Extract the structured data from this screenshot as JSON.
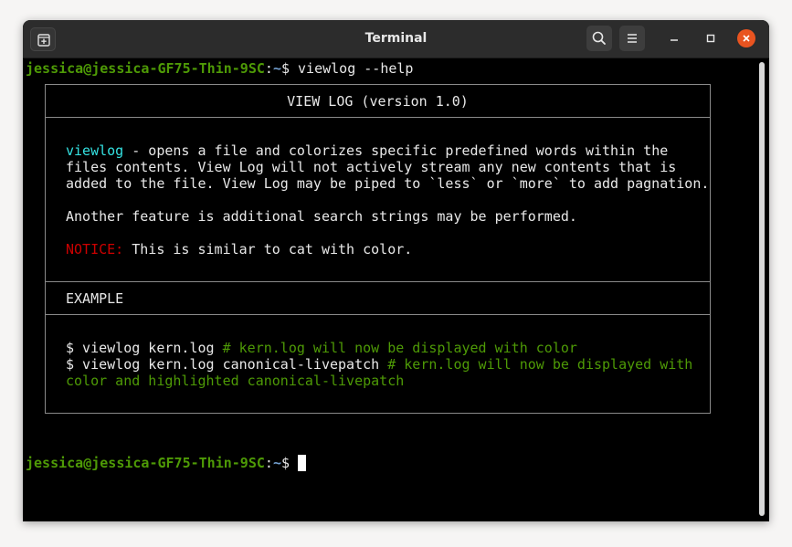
{
  "window": {
    "title": "Terminal"
  },
  "titlebar": {
    "icons": [
      "new-tab-icon",
      "search-icon",
      "hamburger-menu-icon",
      "minimize-icon",
      "maximize-icon",
      "close-icon"
    ]
  },
  "terminal": {
    "prompt1": {
      "user_host": "jessica@jessica-GF75-Thin-9SC",
      "sep": ":",
      "path": "~",
      "symbol": "$ ",
      "command": "viewlog --help"
    },
    "help": {
      "title": "VIEW LOG (version 1.0)",
      "desc_name": "viewlog",
      "desc_line1_rest": " - opens a file and colorizes specific predefined words within the",
      "desc_line2": "files contents. View Log will not actively stream any new contents that is",
      "desc_line3": "added to the file. View Log may be piped to `less` or `more` to add pagnation.",
      "feature_line": "Another feature is additional search strings may be performed.",
      "notice_label": "NOTICE:",
      "notice_text": " This is similar to cat with color.",
      "example_header": "EXAMPLE",
      "ex1_cmd": "$ viewlog kern.log ",
      "ex1_comment": "# kern.log will now be displayed with color",
      "ex2_cmd": "$ viewlog kern.log canonical-livepatch ",
      "ex2_comment": "# kern.log will now be displayed with",
      "ex2_comment_cont": "color and highlighted canonical-livepatch"
    },
    "prompt2": {
      "user_host": "jessica@jessica-GF75-Thin-9SC",
      "sep": ":",
      "path": "~",
      "symbol": "$ "
    }
  },
  "colors": {
    "prompt_user": "#4e9a06",
    "prompt_path": "#729fcf",
    "command_name": "#34e2e2",
    "notice": "#cc0000",
    "comment": "#4e9a06",
    "close_button": "#e95420"
  }
}
